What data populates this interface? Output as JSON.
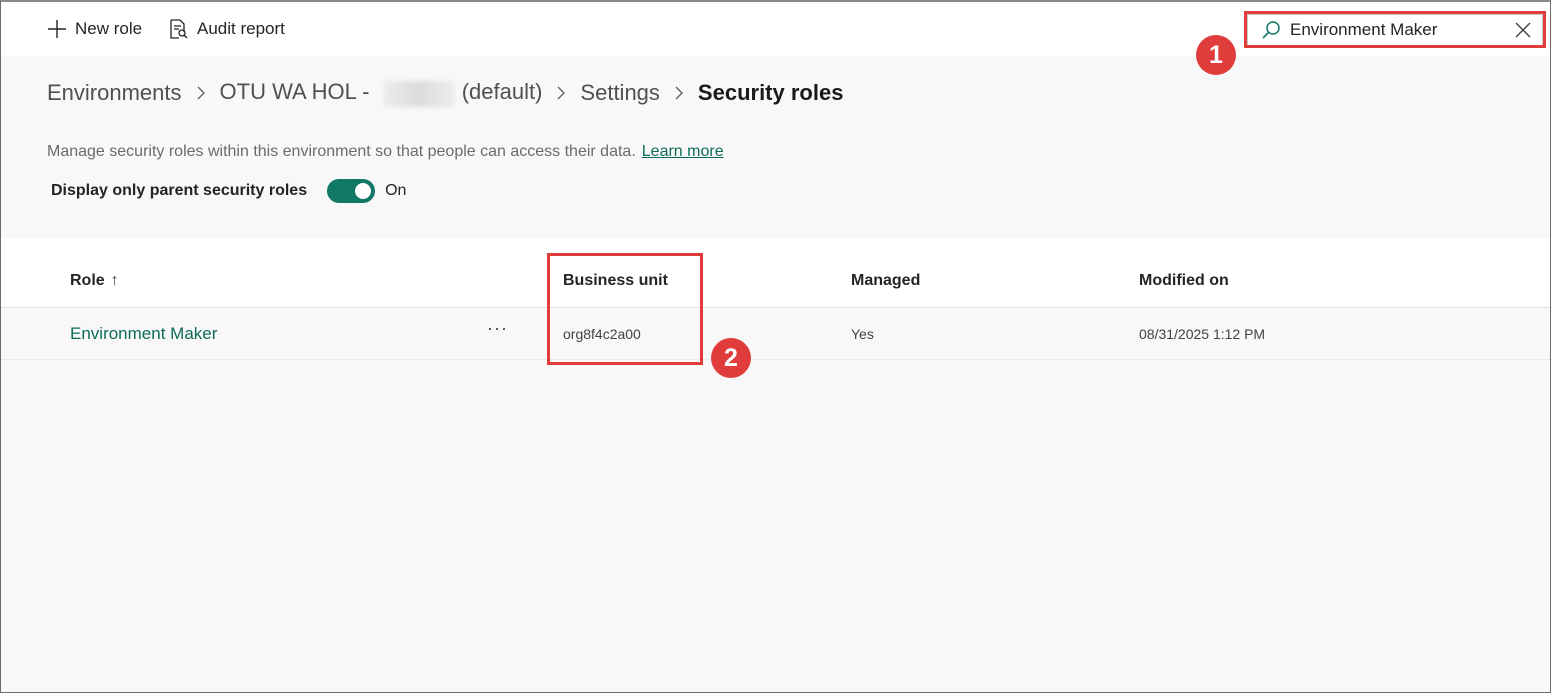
{
  "toolbar": {
    "new_role_label": "New role",
    "audit_report_label": "Audit report"
  },
  "search": {
    "value": "Environment Maker"
  },
  "callouts": [
    "1",
    "2"
  ],
  "breadcrumb": {
    "items": [
      "Environments",
      "OTU WA HOL -",
      "(default)",
      "Settings",
      "Security roles"
    ]
  },
  "description": {
    "text": "Manage security roles within this environment so that people can access their data.",
    "link": "Learn more"
  },
  "toggle": {
    "label": "Display only parent security roles",
    "state": "On"
  },
  "grid": {
    "columns": [
      "Role",
      "Business unit",
      "Managed",
      "Modified on"
    ],
    "sort_indicator": "↑",
    "rows": [
      {
        "role": "Environment Maker",
        "more": "···",
        "business_unit": "org8f4c2a00",
        "managed": "Yes",
        "modified_on": "08/31/2025 1:12 PM"
      }
    ]
  },
  "colors": {
    "accent": "#117865",
    "link": "#0f6b58",
    "highlight": "#e03c3c"
  }
}
